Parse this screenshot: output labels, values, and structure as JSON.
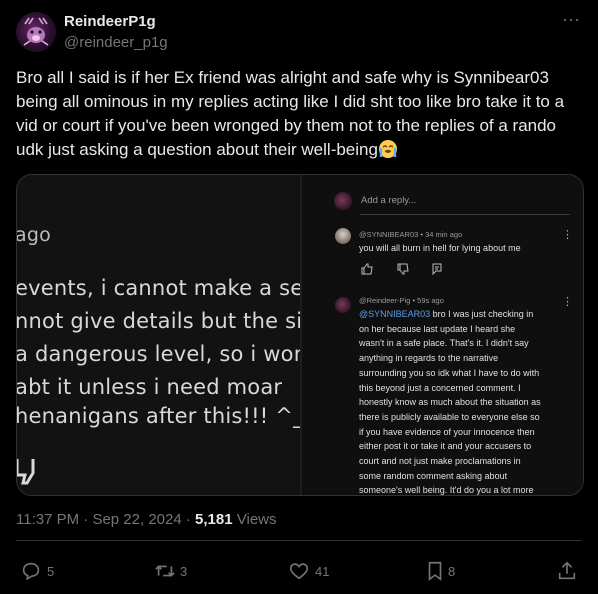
{
  "author": {
    "display_name": "ReindeerP1g",
    "handle": "@reindeer_p1g"
  },
  "tweet": {
    "text": "Bro all I said is if her Ex friend was alright and safe why is Synnibear03 being all ominous in my replies acting like I did sht too like bro take it to a vid or court if you've been wronged by them not to the replies of a rando udk just asking a question about their well-being",
    "emoji": "loudly-crying-face"
  },
  "media": {
    "left_captions": {
      "ago": "ago",
      "line1": "events, i cannot make a se",
      "line2": "nnot give details but the sit",
      "line3": "a dangerous level, so i wont",
      "line4": "abt it unless i need moar",
      "line5": "henanigans after this!!! ^_^"
    },
    "comments_panel": {
      "add_reply_placeholder": "Add a reply...",
      "comments": [
        {
          "author": "@SYNNIBEAR03",
          "time": "34 min ago",
          "meta": "@SYNNIBEAR03 • 34 min ago",
          "text": "you will all burn in hell for lying about me"
        },
        {
          "author": "@Reindeer-Pig",
          "time": "59s ago",
          "meta": "@Reindeer-Pig • 59s ago",
          "mention": "@SYNNIBEAR03",
          "lines": [
            " bro I was just checking in",
            "on her because last update I heard she",
            "wasn't in a safe place. That's it. I didn't say",
            "anything in regards to the narrative",
            "surrounding you so idk what I have to do with",
            "this beyond just a concerned comment. I",
            "honestly know as much about the situation as",
            "there is publicly available to everyone else so",
            "if you have evidence of your innocence then",
            "either post it or take it and your accusers to",
            "court and not just make proclamations in",
            "some random comment asking about",
            "someone's well being. It'd do you a lot more"
          ]
        }
      ]
    }
  },
  "timestamp": {
    "time": "11:37 PM",
    "dot": "·",
    "date": "Sep 22, 2024",
    "views_count": "5,181",
    "views_label": "Views"
  },
  "actions": {
    "replies": "5",
    "reposts": "3",
    "likes": "41",
    "bookmarks": "8"
  },
  "colors": {
    "background": "#000000",
    "text_primary": "#e7e9ea",
    "text_secondary": "#71767b",
    "border": "#2f3336",
    "mention": "#5f9be8"
  }
}
